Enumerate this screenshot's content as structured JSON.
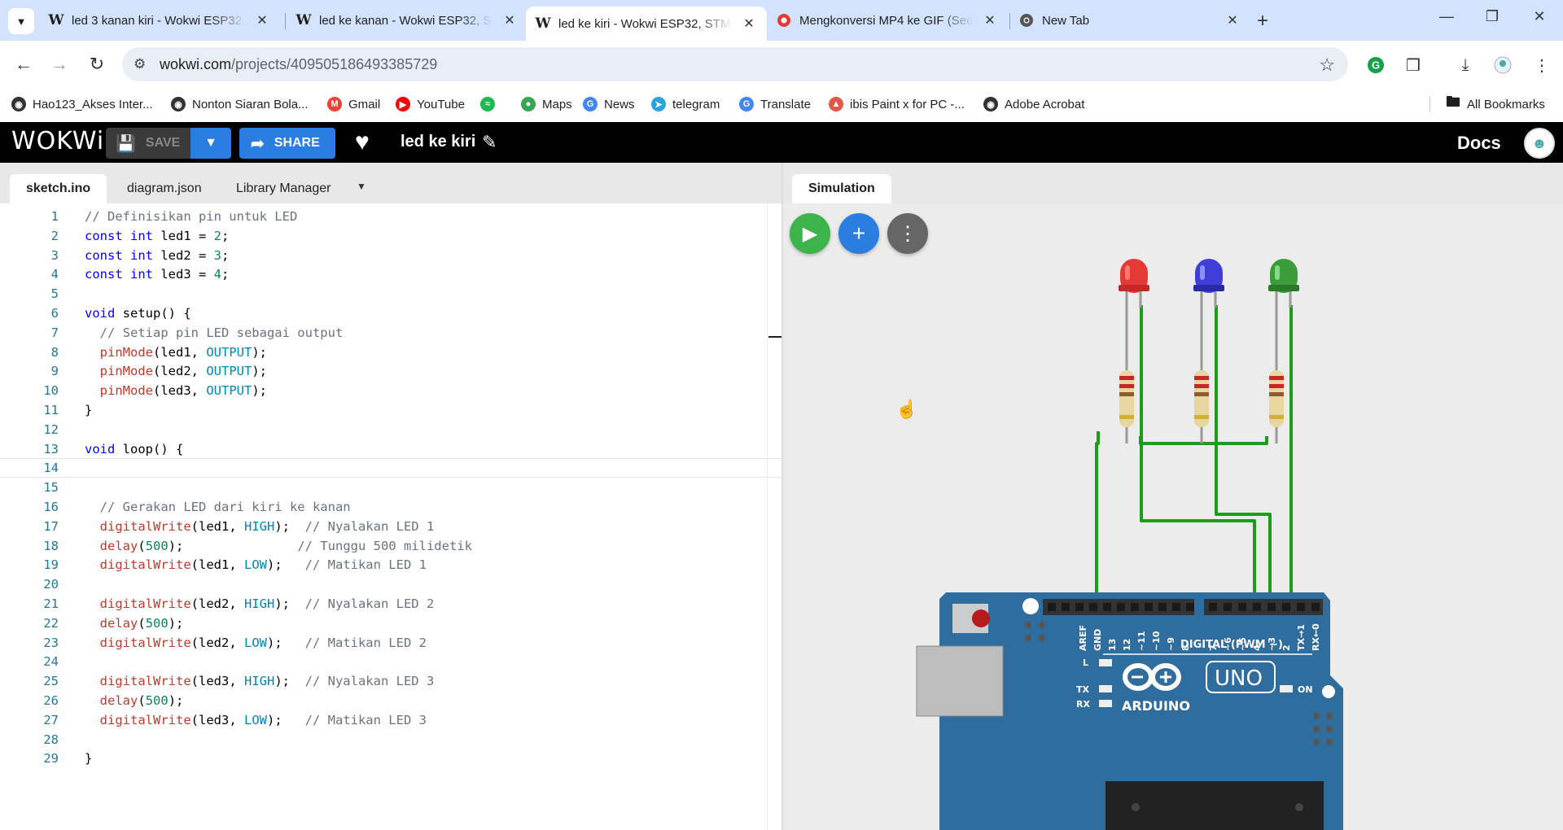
{
  "browser": {
    "tabs": [
      {
        "title": "led 3 kanan kiri - Wokwi ESP32,",
        "favicon": "W",
        "active": false
      },
      {
        "title": "led ke kanan - Wokwi ESP32, ST",
        "favicon": "W",
        "active": false
      },
      {
        "title": "led ke kiri - Wokwi ESP32, STM3",
        "favicon": "W",
        "active": true
      },
      {
        "title": "Mengkonversi MP4 ke GIF (Seca",
        "favicon": "mp4-gif-icon",
        "active": false
      },
      {
        "title": "New Tab",
        "favicon": "chrome-icon",
        "active": false
      }
    ],
    "close_glyph": "✕",
    "new_tab_glyph": "+",
    "url": {
      "domain": "wokwi.com",
      "path": "/projects/409505186493385729"
    },
    "bookmarks": [
      {
        "label": "Hao123_Akses Inter...",
        "icon": "globe-icon",
        "color": "#333333"
      },
      {
        "label": "Nonton Siaran Bola...",
        "icon": "globe-icon",
        "color": "#333333"
      },
      {
        "label": "Gmail",
        "icon": "gmail-icon",
        "color": "#ea4335"
      },
      {
        "label": "YouTube",
        "icon": "youtube-icon",
        "color": "#ff0000"
      },
      {
        "label": "",
        "icon": "spotify-icon",
        "color": "#1db954"
      },
      {
        "label": "Maps",
        "icon": "maps-icon",
        "color": "#34a853"
      },
      {
        "label": "News",
        "icon": "news-icon",
        "color": "#4285f4"
      },
      {
        "label": "telegram",
        "icon": "telegram-icon",
        "color": "#2aa3df"
      },
      {
        "label": "Translate",
        "icon": "translate-icon",
        "color": "#4285f4"
      },
      {
        "label": "ibis Paint x for PC -...",
        "icon": "ibis-icon",
        "color": "#e05a4a"
      },
      {
        "label": "Adobe Acrobat",
        "icon": "globe-icon",
        "color": "#333333"
      }
    ],
    "all_bookmarks": "All Bookmarks"
  },
  "wokwi": {
    "logo": "WOKWi",
    "save_label": "SAVE",
    "share_label": "SHARE",
    "project_name": "led ke kiri",
    "docs_label": "Docs",
    "editor_tabs": [
      "sketch.ino",
      "diagram.json",
      "Library Manager"
    ],
    "sim_tab": "Simulation"
  },
  "code_lines": [
    {
      "n": "1",
      "html": "<span class='tk-c'>// Definisikan pin untuk LED</span>"
    },
    {
      "n": "2",
      "html": "<span class='tk-k'>const int</span> led1 = <span class='tk-n'>2</span>;"
    },
    {
      "n": "3",
      "html": "<span class='tk-k'>const int</span> led2 = <span class='tk-n'>3</span>;"
    },
    {
      "n": "4",
      "html": "<span class='tk-k'>const int</span> led3 = <span class='tk-n'>4</span>;"
    },
    {
      "n": "5",
      "html": ""
    },
    {
      "n": "6",
      "html": "<span class='tk-k'>void</span> setup() {"
    },
    {
      "n": "7",
      "html": "  <span class='tk-c'>// Setiap pin LED sebagai output</span>"
    },
    {
      "n": "8",
      "html": "  <span class='tk-f'>pinMode</span>(led1, <span class='tk-const'>OUTPUT</span>);"
    },
    {
      "n": "9",
      "html": "  <span class='tk-f'>pinMode</span>(led2, <span class='tk-const'>OUTPUT</span>);"
    },
    {
      "n": "10",
      "html": "  <span class='tk-f'>pinMode</span>(led3, <span class='tk-const'>OUTPUT</span>);"
    },
    {
      "n": "11",
      "html": "}"
    },
    {
      "n": "12",
      "html": ""
    },
    {
      "n": "13",
      "html": "<span class='tk-k'>void</span> loop() {"
    },
    {
      "n": "14",
      "html": ""
    },
    {
      "n": "15",
      "html": ""
    },
    {
      "n": "16",
      "html": "  <span class='tk-c'>// Gerakan LED dari kiri ke kanan</span>"
    },
    {
      "n": "17",
      "html": "  <span class='tk-f'>digitalWrite</span>(led1, <span class='tk-const'>HIGH</span>);  <span class='tk-c'>// Nyalakan LED 1</span>"
    },
    {
      "n": "18",
      "html": "  <span class='tk-f'>delay</span>(<span class='tk-n'>500</span>);               <span class='tk-c'>// Tunggu 500 milidetik</span>"
    },
    {
      "n": "19",
      "html": "  <span class='tk-f'>digitalWrite</span>(led1, <span class='tk-const'>LOW</span>);   <span class='tk-c'>// Matikan LED 1</span>"
    },
    {
      "n": "20",
      "html": ""
    },
    {
      "n": "21",
      "html": "  <span class='tk-f'>digitalWrite</span>(led2, <span class='tk-const'>HIGH</span>);  <span class='tk-c'>// Nyalakan LED 2</span>"
    },
    {
      "n": "22",
      "html": "  <span class='tk-f'>delay</span>(<span class='tk-n'>500</span>);"
    },
    {
      "n": "23",
      "html": "  <span class='tk-f'>digitalWrite</span>(led2, <span class='tk-const'>LOW</span>);   <span class='tk-c'>// Matikan LED 2</span>"
    },
    {
      "n": "24",
      "html": ""
    },
    {
      "n": "25",
      "html": "  <span class='tk-f'>digitalWrite</span>(led3, <span class='tk-const'>HIGH</span>);  <span class='tk-c'>// Nyalakan LED 3</span>"
    },
    {
      "n": "26",
      "html": "  <span class='tk-f'>delay</span>(<span class='tk-n'>500</span>);"
    },
    {
      "n": "27",
      "html": "  <span class='tk-f'>digitalWrite</span>(led3, <span class='tk-const'>LOW</span>);   <span class='tk-c'>// Matikan LED 3</span>"
    },
    {
      "n": "28",
      "html": ""
    },
    {
      "n": "29",
      "html": "}"
    }
  ],
  "current_line": "14",
  "board": {
    "pin_labels": [
      "AREF",
      "GND",
      "13",
      "12",
      "~11",
      "~10",
      "~9",
      "8",
      "7",
      "~6",
      "~5",
      "4",
      "~3",
      "2",
      "TX→1",
      "RX←0"
    ],
    "digital_label": "DIGITAL (PWM ~)",
    "brand": "ARDUINO",
    "model": "UNO",
    "led_labels": [
      "L",
      "TX",
      "RX",
      "ON"
    ]
  },
  "leds": [
    {
      "color_name": "red",
      "color": "#e53935"
    },
    {
      "color_name": "blue",
      "color": "#3f3fd8"
    },
    {
      "color_name": "green",
      "color": "#3a9d3a"
    }
  ],
  "colors": {
    "wire": "#1a9e1a",
    "board": "#2f6d9e",
    "play": "#3cb44b",
    "add": "#2a7de1",
    "more": "#666666"
  }
}
